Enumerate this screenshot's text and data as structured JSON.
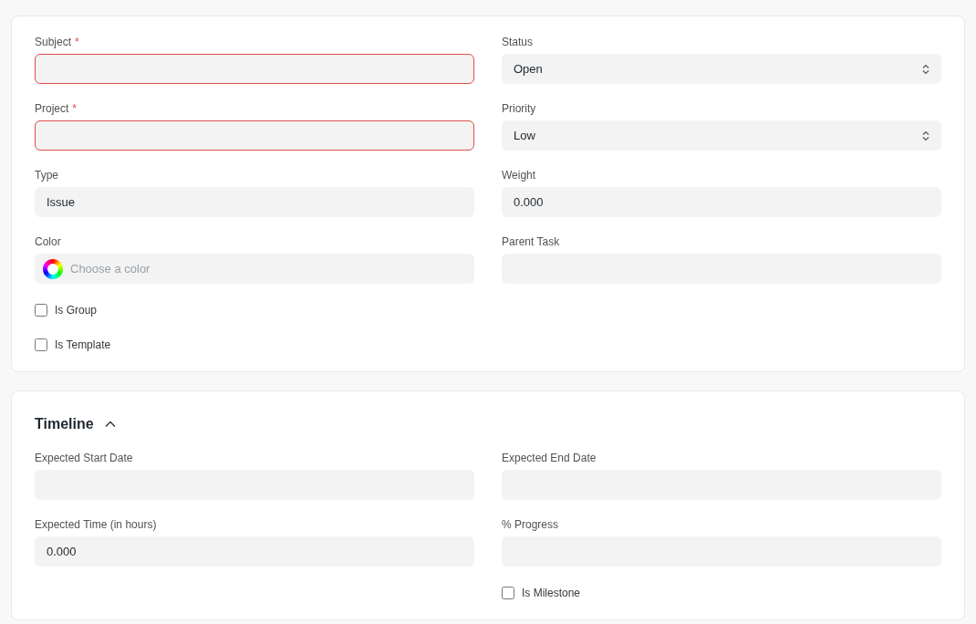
{
  "sections": [
    {
      "columns": [
        [
          {
            "kind": "text",
            "label": "Subject",
            "required_mark": "*",
            "invalid": true
          },
          {
            "kind": "text",
            "label": "Project",
            "required_mark": "*",
            "invalid": true
          },
          {
            "kind": "text",
            "label": "Type",
            "invalid": false,
            "value": "Issue"
          },
          {
            "kind": "color",
            "label": "Color",
            "invalid": false,
            "placeholder": "Choose a color"
          },
          {
            "kind": "checkbox",
            "label": "Is Group",
            "checked": false
          },
          {
            "kind": "checkbox",
            "label": "Is Template",
            "checked": false
          }
        ],
        [
          {
            "kind": "select",
            "label": "Status",
            "invalid": false,
            "value": "Open"
          },
          {
            "kind": "select",
            "label": "Priority",
            "invalid": false,
            "value": "Low"
          },
          {
            "kind": "text",
            "label": "Weight",
            "invalid": false,
            "value": "0.000"
          },
          {
            "kind": "text",
            "label": "Parent Task",
            "invalid": false
          }
        ]
      ]
    },
    {
      "title": "Timeline",
      "expanded": true,
      "columns": [
        [
          {
            "kind": "text",
            "label": "Expected Start Date",
            "invalid": false
          },
          {
            "kind": "text",
            "label": "Expected Time (in hours)",
            "invalid": false,
            "value": "0.000"
          }
        ],
        [
          {
            "kind": "text",
            "label": "Expected End Date",
            "invalid": false
          },
          {
            "kind": "text",
            "label": "% Progress",
            "invalid": false
          },
          {
            "kind": "checkbox",
            "label": "Is Milestone",
            "checked": false
          }
        ]
      ]
    }
  ]
}
